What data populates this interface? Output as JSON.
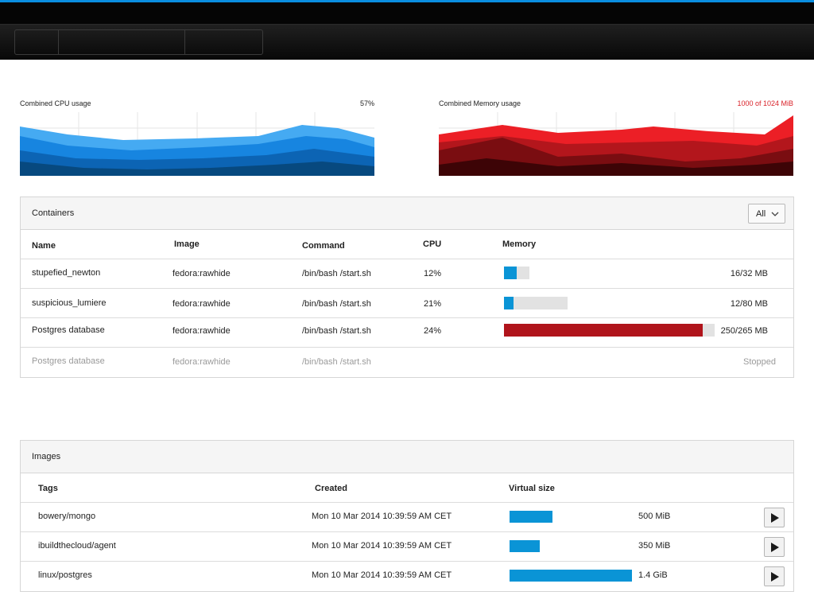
{
  "colors": {
    "accent_blue": "#0a8ee0",
    "memory_red": "#b0141b",
    "bar_blue": "#0a94d6",
    "bar_track": "#e2e2e2"
  },
  "cpu_chart": {
    "title": "Combined CPU usage",
    "value": "57%"
  },
  "memory_chart": {
    "title": "Combined Memory usage",
    "value": "1000 of 1024 MiB"
  },
  "containers": {
    "title": "Containers",
    "filter": {
      "selected": "All",
      "icon": "chevron-down-icon"
    },
    "headers": {
      "name": "Name",
      "image": "Image",
      "command": "Command",
      "cpu": "CPU",
      "memory": "Memory"
    },
    "rows": [
      {
        "name": "stupefied_newton",
        "image": "fedora:rawhide",
        "command": "/bin/bash /start.sh",
        "cpu": "12%",
        "memory": "16/32 MB",
        "used": 16,
        "total": 32,
        "color": "#0a94d6"
      },
      {
        "name": "suspicious_lumiere",
        "image": "fedora:rawhide",
        "command": "/bin/bash /start.sh",
        "cpu": "21%",
        "memory": "12/80 MB",
        "used": 12,
        "total": 80,
        "color": "#0a94d6"
      },
      {
        "name": "Postgres database",
        "image": "fedora:rawhide",
        "command": "/bin/bash /start.sh",
        "cpu": "24%",
        "memory": "250/265 MB",
        "used": 250,
        "total": 265,
        "color": "#b0141b"
      },
      {
        "name": "Postgres database",
        "image": "fedora:rawhide",
        "command": "/bin/bash /start.sh",
        "cpu": "",
        "memory": "Stopped",
        "stopped": true
      }
    ]
  },
  "images": {
    "title": "Images",
    "headers": {
      "tags": "Tags",
      "created": "Created",
      "size": "Virtual size"
    },
    "rows": [
      {
        "tag": "bowery/mongo",
        "created": "Mon 10 Mar 2014 10:39:59 AM CET",
        "size": "500 MiB",
        "size_mib": 500,
        "action_icon": "play-icon"
      },
      {
        "tag": "ibuildthecloud/agent",
        "created": "Mon 10 Mar 2014 10:39:59 AM CET",
        "size": "350 MiB",
        "size_mib": 350,
        "action_icon": "play-icon"
      },
      {
        "tag": "linux/postgres",
        "created": "Mon 10 Mar 2014 10:39:59 AM CET",
        "size": "1.4 GiB",
        "size_mib": 1434,
        "action_icon": "play-icon"
      }
    ]
  }
}
